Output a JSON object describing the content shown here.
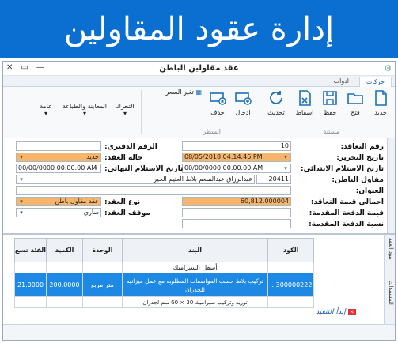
{
  "banner": {
    "title": "إدارة عقود المقاولين"
  },
  "window": {
    "title": "عقد مقاولين الباطن",
    "close": "✕",
    "restore": "▭",
    "minimize": "—"
  },
  "tabs": [
    {
      "label": "حركات"
    },
    {
      "label": "ادوات"
    }
  ],
  "ribbon": {
    "new": "جديد",
    "open": "فتح",
    "save": "حفظ",
    "drop": "اسقاط",
    "update": "تحديث",
    "insert": "ادخال",
    "delete": "حذف",
    "move": "التحرك",
    "preview": "المعاينة والطباعة",
    "general": "عامة",
    "price_change": "تغير السعر",
    "group_document": "مستند",
    "group_line": "السطر"
  },
  "form": {
    "labels": {
      "contract_no": "رقم التعاقد:",
      "edit_date": "تاريخ التحرير:",
      "initial_receipt_date": "تاريخ الاستلام الابتدائي:",
      "subcontractor": "مقاول الباطن:",
      "address": "العنوان:",
      "total_value": "اجمالي قيمة التعاقد:",
      "advance_value": "قيمة الدفعة المقدمة:",
      "advance_pct": "نسبة الدفعة المقدمة:",
      "book_no": "الرقم الدفتري:",
      "contract_status": "حالة العقد:",
      "final_receipt_date": "تاريخ الاستلام النهائي:",
      "contract_type": "نوع العقد:",
      "contract_stop": "موقف العقد:"
    },
    "values": {
      "contract_no": "10",
      "edit_date": "08/05/2018 04.14.46 PM",
      "initial_receipt_date": "00/00/0000 00.00.00 AM",
      "subcontractor_code": "20411",
      "subcontractor_name": "عبدالرزاق عبدالمنعم بلاط العتيم الخير",
      "total_value": "60,812.000004",
      "book_no": "",
      "contract_status": "جديد",
      "final_receipt_date": "00/00/0000 00.00.00 AM",
      "contract_type": "عقد مقاول باطن",
      "contract_stop": "ساري"
    }
  },
  "grid": {
    "columns": [
      "الكود",
      "البند",
      "الوحدة",
      "الكمية",
      "الفئة تسع"
    ],
    "rows": [
      {
        "code": "",
        "item": "أسفل السيراميك",
        "unit": "",
        "qty": "",
        "price": ""
      },
      {
        "code": "300000222...",
        "item": "تركيب بلاط حسب المواصفات المطلوبه مع عمل ميزانيه للجدران",
        "unit": "متر مربع",
        "qty": "200.0000",
        "price": "21.0000"
      },
      {
        "code": "",
        "item": "توريد وتركيب سيراميك 30 × 60 سم لجدران",
        "unit": "",
        "qty": "",
        "price": ""
      }
    ]
  },
  "side_tabs": {
    "contract_items": "بنود العقد",
    "documents": "المستندات"
  },
  "exec_link": "إبدأ التنفيذ"
}
